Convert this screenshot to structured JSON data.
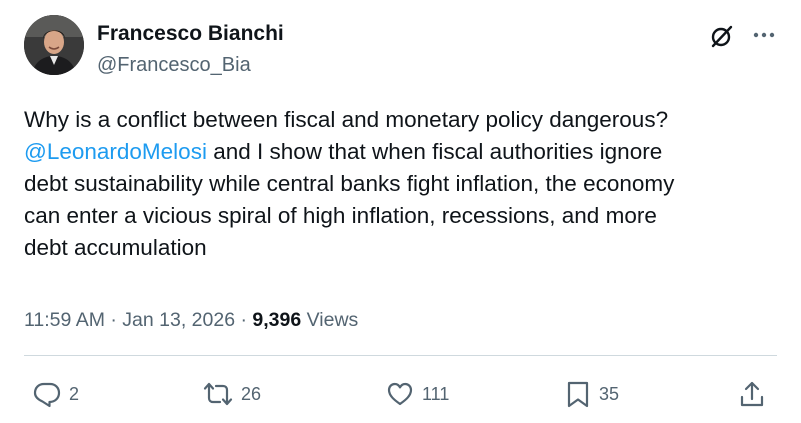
{
  "author": {
    "name": "Francesco Bianchi",
    "handle": "@Francesco_Bia",
    "avatar_icon": "person-avatar"
  },
  "header_icons": [
    "grok-icon",
    "more-icon"
  ],
  "tweet": {
    "line1": "Why is a conflict between fiscal and monetary policy dangerous?",
    "mention": "@LeonardoMelosi",
    "line2_rest": " and I show that when fiscal authorities ignore",
    "line3": "debt sustainability while central banks fight inflation, the economy",
    "line4": "can enter a vicious spiral of high inflation, recessions, and more",
    "line5": "debt accumulation"
  },
  "meta": {
    "time": "11:59 AM",
    "separator1": " · ",
    "date": "Jan 13, 2026",
    "separator2": " · ",
    "views_count": "9,396",
    "views_label": " Views"
  },
  "actions": {
    "replies": "2",
    "reposts": "26",
    "likes": "111",
    "bookmarks": "35"
  },
  "colors": {
    "text": "#0f1419",
    "secondary": "#536471",
    "link": "#1d9bf0",
    "divider": "#cfd9de"
  }
}
